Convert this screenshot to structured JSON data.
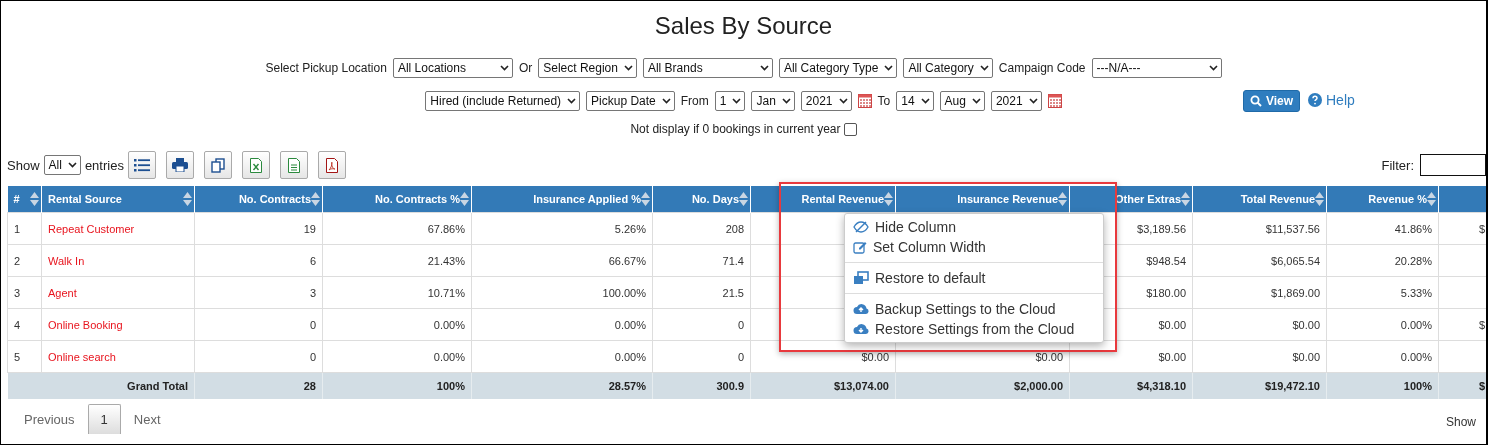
{
  "title": "Sales By Source",
  "filter_rows": [
    [
      {
        "kind": "label",
        "text": "Select Pickup Location"
      },
      {
        "kind": "select",
        "text": "All Locations"
      },
      {
        "kind": "label",
        "text": "Or"
      },
      {
        "kind": "select",
        "text": "Select Region"
      },
      {
        "kind": "select",
        "text": "All Brands"
      },
      {
        "kind": "select",
        "text": "All Category Type"
      },
      {
        "kind": "select",
        "text": "All Category"
      },
      {
        "kind": "label",
        "text": "Campaign Code"
      },
      {
        "kind": "select",
        "text": "---N/A---"
      }
    ],
    [
      {
        "kind": "select",
        "text": "Hired (include Returned)"
      },
      {
        "kind": "select",
        "text": "Pickup Date"
      },
      {
        "kind": "label",
        "text": "From"
      },
      {
        "kind": "select",
        "text": "1"
      },
      {
        "kind": "select",
        "text": "Jan"
      },
      {
        "kind": "select",
        "text": "2021"
      },
      {
        "kind": "calendar"
      },
      {
        "kind": "label",
        "text": "To"
      },
      {
        "kind": "select",
        "text": "14"
      },
      {
        "kind": "select",
        "text": "Aug"
      },
      {
        "kind": "select",
        "text": "2021"
      },
      {
        "kind": "calendar"
      }
    ]
  ],
  "view_button": "View",
  "help_link": "Help",
  "zero_option": {
    "label": "Not display if 0 bookings in current year",
    "checked": false
  },
  "show_label": "Show",
  "show_value": "All",
  "entries_label": "entries",
  "filter_label": "Filter:",
  "columns": [
    "#",
    "Rental Source",
    "No. Contracts",
    "No. Contracts %",
    "Insurance Applied %",
    "No. Days",
    "Rental Revenue",
    "Insurance Revenue",
    "Other Extras",
    "Total Revenue",
    "Revenue %",
    null
  ],
  "rows": [
    [
      "1",
      "Repeat Customer",
      "19",
      "67.86%",
      "5.26%",
      "208",
      null,
      null,
      "$3,189.56",
      "$11,537.56",
      "41.86%",
      "$"
    ],
    [
      "2",
      "Walk In",
      "6",
      "21.43%",
      "66.67%",
      "71.4",
      null,
      null,
      "$948.54",
      "$6,065.54",
      "20.28%",
      null
    ],
    [
      "3",
      "Agent",
      "3",
      "10.71%",
      "100.00%",
      "21.5",
      null,
      null,
      "$180.00",
      "$1,869.00",
      "5.33%",
      null
    ],
    [
      "4",
      "Online Booking",
      "0",
      "0.00%",
      "0.00%",
      "0",
      null,
      null,
      "$0.00",
      "$0.00",
      "0.00%",
      "$"
    ],
    [
      "5",
      "Online search",
      "0",
      "0.00%",
      "0.00%",
      "0",
      "$0.00",
      "$0.00",
      "$0.00",
      "$0.00",
      "0.00%",
      null
    ]
  ],
  "grand_total": [
    "Grand Total",
    "28",
    "100%",
    "28.57%",
    "300.9",
    "$13,074.00",
    "$2,000.00",
    "$4,318.10",
    "$19,472.10",
    "100%",
    "$"
  ],
  "pager": [
    {
      "label": "Previous",
      "kind": "link",
      "selected": false
    },
    {
      "label": "1",
      "kind": "page",
      "selected": true
    },
    {
      "label": "Next",
      "kind": "link",
      "selected": false
    }
  ],
  "footer_show": "Show",
  "context_menu": [
    [
      "Hide Column",
      "Set Column Width"
    ],
    [
      "Restore to default"
    ],
    [
      "Backup Settings to the Cloud",
      "Restore Settings from the Cloud"
    ]
  ]
}
